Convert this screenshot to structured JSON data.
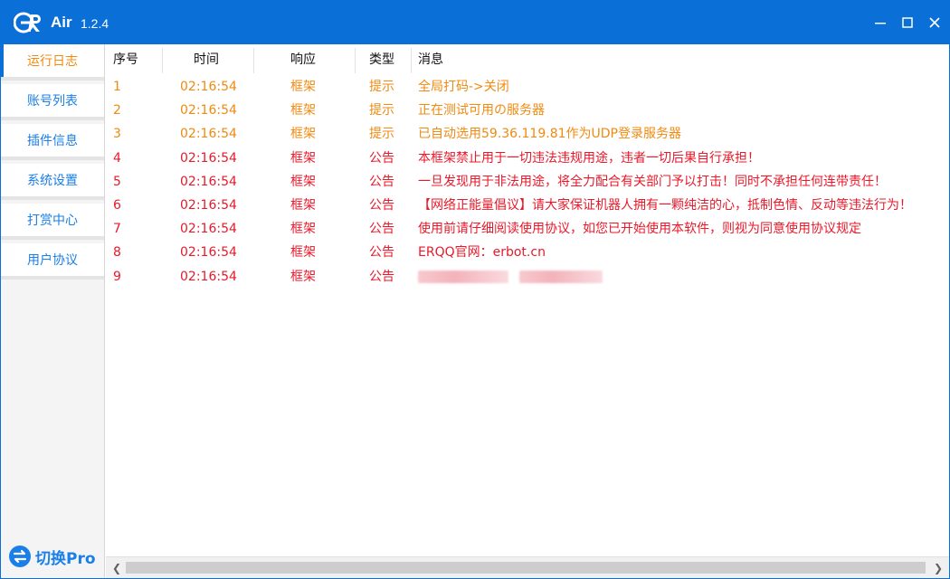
{
  "app": {
    "name": "Air",
    "version": "1.2.4"
  },
  "window_controls": {
    "minimize_icon": "minimize-icon",
    "maximize_icon": "maximize-icon",
    "close_icon": "close-icon"
  },
  "sidebar": {
    "items": [
      {
        "label": "运行日志",
        "active": true
      },
      {
        "label": "账号列表",
        "active": false
      },
      {
        "label": "插件信息",
        "active": false
      },
      {
        "label": "系统设置",
        "active": false
      },
      {
        "label": "打赏中心",
        "active": false
      },
      {
        "label": "用户协议",
        "active": false
      }
    ],
    "switch_label": "切换Pro"
  },
  "table": {
    "columns": [
      "序号",
      "时间",
      "响应",
      "类型",
      "消息"
    ],
    "rows": [
      {
        "idx": "1",
        "time": "02:16:54",
        "resp": "框架",
        "type": "提示",
        "msg": "全局打码->关闭",
        "kind": "tip"
      },
      {
        "idx": "2",
        "time": "02:16:54",
        "resp": "框架",
        "type": "提示",
        "msg": "正在测试可用の服务器",
        "kind": "tip"
      },
      {
        "idx": "3",
        "time": "02:16:54",
        "resp": "框架",
        "type": "提示",
        "msg": "已自动选用59.36.119.81作为UDP登录服务器",
        "kind": "tip"
      },
      {
        "idx": "4",
        "time": "02:16:54",
        "resp": "框架",
        "type": "公告",
        "msg": "本框架禁止用于一切违法违规用途，违者一切后果自行承担！",
        "kind": "notice"
      },
      {
        "idx": "5",
        "time": "02:16:54",
        "resp": "框架",
        "type": "公告",
        "msg": "一旦发现用于非法用途，将全力配合有关部门予以打击！同时不承担任何连带责任！",
        "kind": "notice"
      },
      {
        "idx": "6",
        "time": "02:16:54",
        "resp": "框架",
        "type": "公告",
        "msg": "【网络正能量倡议】请大家保证机器人拥有一颗纯洁的心，抵制色情、反动等违法行为！",
        "kind": "notice"
      },
      {
        "idx": "7",
        "time": "02:16:54",
        "resp": "框架",
        "type": "公告",
        "msg": "使用前请仔细阅读使用协议，如您已开始使用本软件，则视为同意使用协议规定",
        "kind": "notice"
      },
      {
        "idx": "8",
        "time": "02:16:54",
        "resp": "框架",
        "type": "公告",
        "msg": "ERQQ官网：erbot.cn",
        "kind": "notice"
      },
      {
        "idx": "9",
        "time": "02:16:54",
        "resp": "框架",
        "type": "公告",
        "msg": "",
        "kind": "notice",
        "redacted": true
      }
    ]
  },
  "colors": {
    "brand": "#0a6fd6",
    "tip": "#f08a10",
    "notice": "#e8192a",
    "nav_text": "#1a7fe8"
  }
}
